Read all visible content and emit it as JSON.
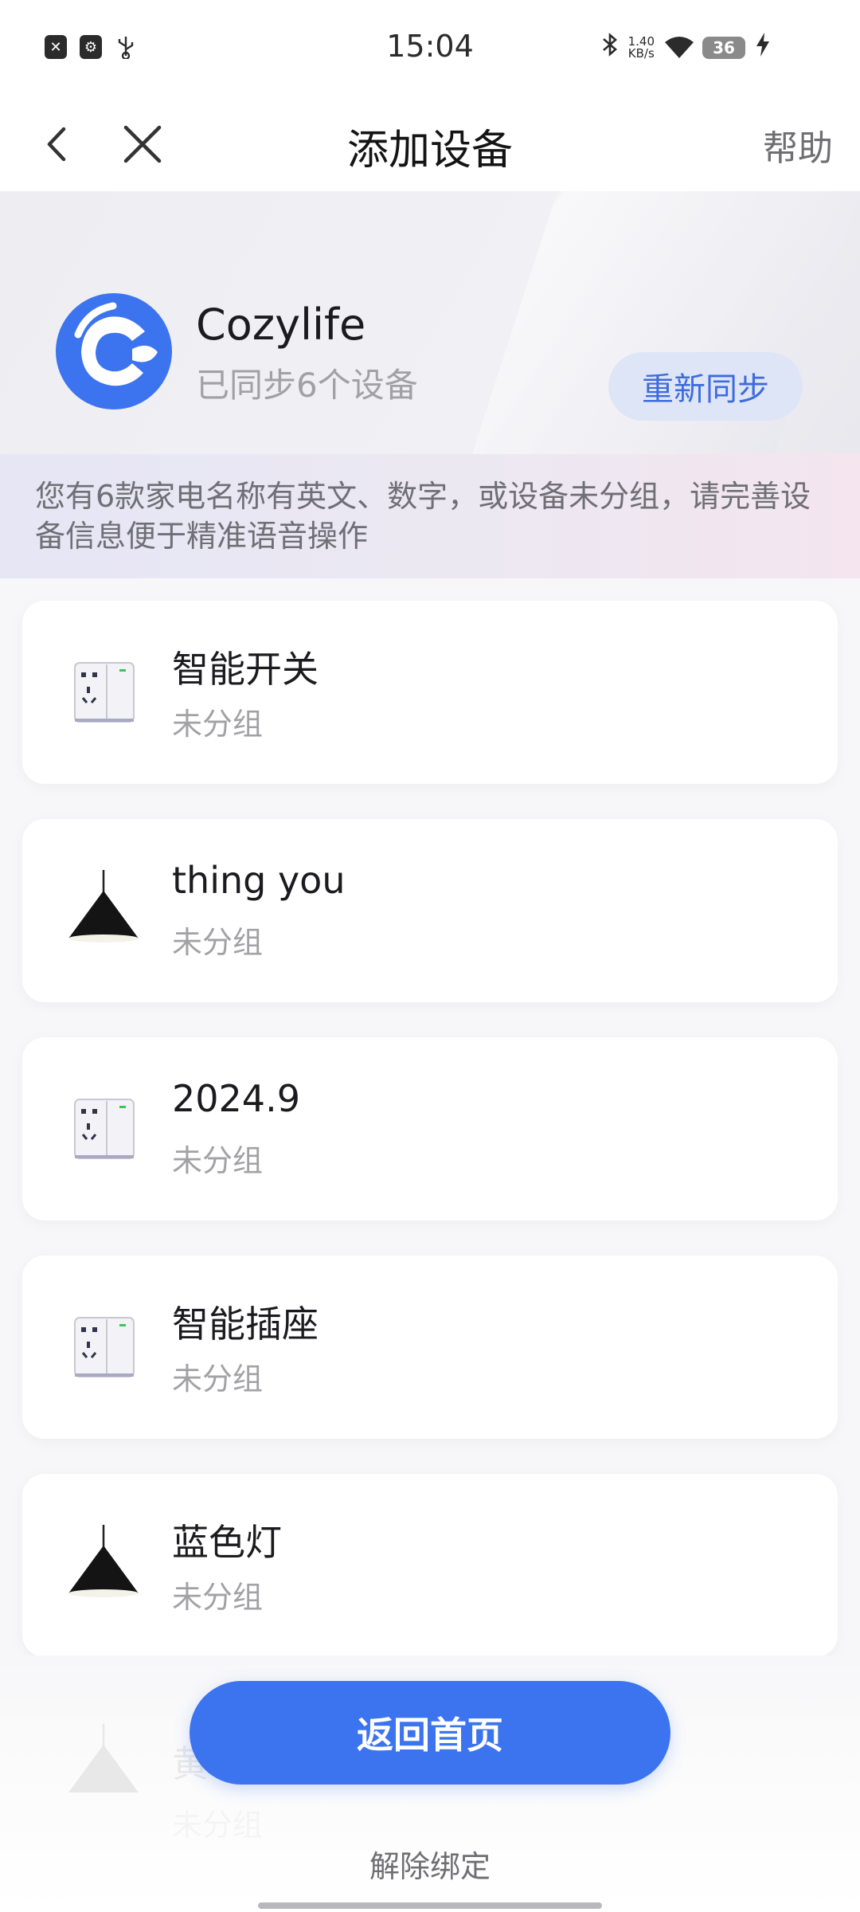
{
  "status_bar": {
    "time": "15:04",
    "net_speed_value": "1.40",
    "net_speed_unit": "KB/s",
    "battery": "36",
    "icons": [
      "close-box-icon",
      "usb-debug-icon",
      "usb-icon",
      "bluetooth-icon",
      "wifi-icon",
      "battery-icon",
      "charging-icon"
    ]
  },
  "header": {
    "title": "添加设备",
    "help": "帮助"
  },
  "banner": {
    "app_name": "Cozylife",
    "sync_status": "已同步6个设备",
    "resync_label": "重新同步",
    "brand_color": "#3c74f0"
  },
  "notice": {
    "text": "您有6款家电名称有英文、数字，或设备未分组，请完善设备信息便于精准语音操作"
  },
  "devices": [
    {
      "name": "智能开关",
      "group": "未分组",
      "icon": "smart-switch-icon"
    },
    {
      "name": "thing you",
      "group": "未分组",
      "icon": "pendant-lamp-icon"
    },
    {
      "name": "2024.9",
      "group": "未分组",
      "icon": "smart-switch-icon"
    },
    {
      "name": "智能插座",
      "group": "未分组",
      "icon": "smart-switch-icon"
    },
    {
      "name": "蓝色灯",
      "group": "未分组",
      "icon": "pendant-lamp-icon"
    },
    {
      "name": "黄",
      "group": "未分组",
      "icon": "pendant-lamp-icon"
    }
  ],
  "footer": {
    "home_label": "返回首页",
    "unbind_label": "解除绑定"
  }
}
